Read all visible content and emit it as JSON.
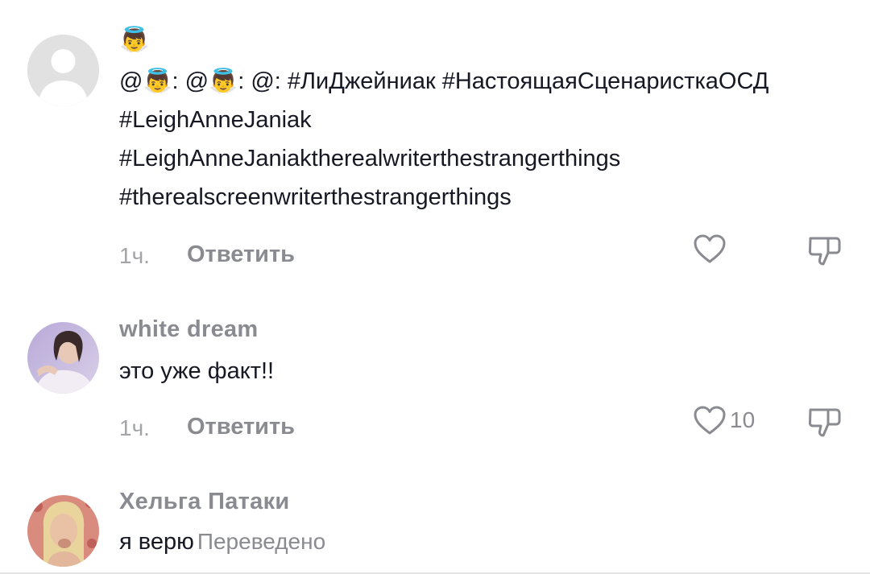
{
  "comments": [
    {
      "username": "👼",
      "lines": [
        "@👼: @👼: @: #ЛиДжейниак #НастоящаяСценаристкаОСД",
        "#LeighAnneJaniak",
        "#LeighAnneJaniaktherealwriterthestrangerthings",
        "#therealscreenwriterthestrangerthings"
      ],
      "time": "1ч.",
      "reply_label": "Ответить",
      "like_count": ""
    },
    {
      "username": "white dream",
      "lines": [
        "это уже факт!!"
      ],
      "time": "1ч.",
      "reply_label": "Ответить",
      "like_count": "10"
    },
    {
      "username": "Хельга Патаки",
      "text": "я верю",
      "translated_label": "Переведено"
    }
  ],
  "colors": {
    "primary_text": "#161823",
    "secondary_text": "#8a8b91",
    "muted_text": "#a3a4a8",
    "default_avatar_bg": "#e1e1e2"
  },
  "icons": [
    "default-avatar-icon",
    "heart-icon",
    "dislike-icon"
  ]
}
